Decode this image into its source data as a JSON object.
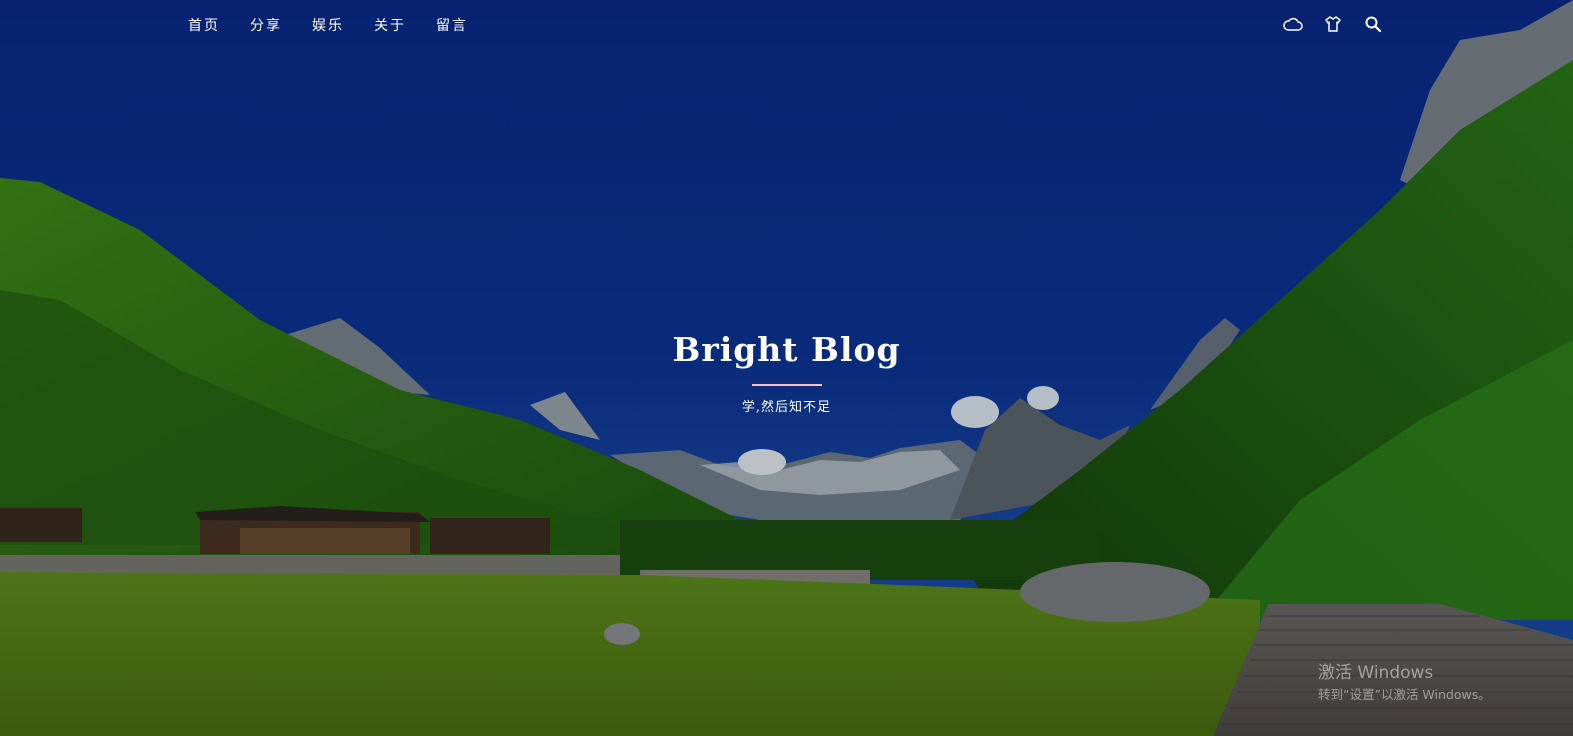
{
  "nav": {
    "items": [
      {
        "label": "首页"
      },
      {
        "label": "分享"
      },
      {
        "label": "娱乐"
      },
      {
        "label": "关于"
      },
      {
        "label": "留言"
      }
    ],
    "tools": [
      {
        "icon": "cloud-icon"
      },
      {
        "icon": "shirt-icon"
      },
      {
        "icon": "search-icon"
      }
    ]
  },
  "hero": {
    "title": "Bright Blog",
    "subtitle": "学,然后知不足"
  },
  "watermark": {
    "line1": "激活 Windows",
    "line2": "转到“设置”以激活 Windows。"
  },
  "colors": {
    "sky": "#0a2b8c",
    "divider": "#f2c4d0",
    "text": "#ffffff"
  }
}
